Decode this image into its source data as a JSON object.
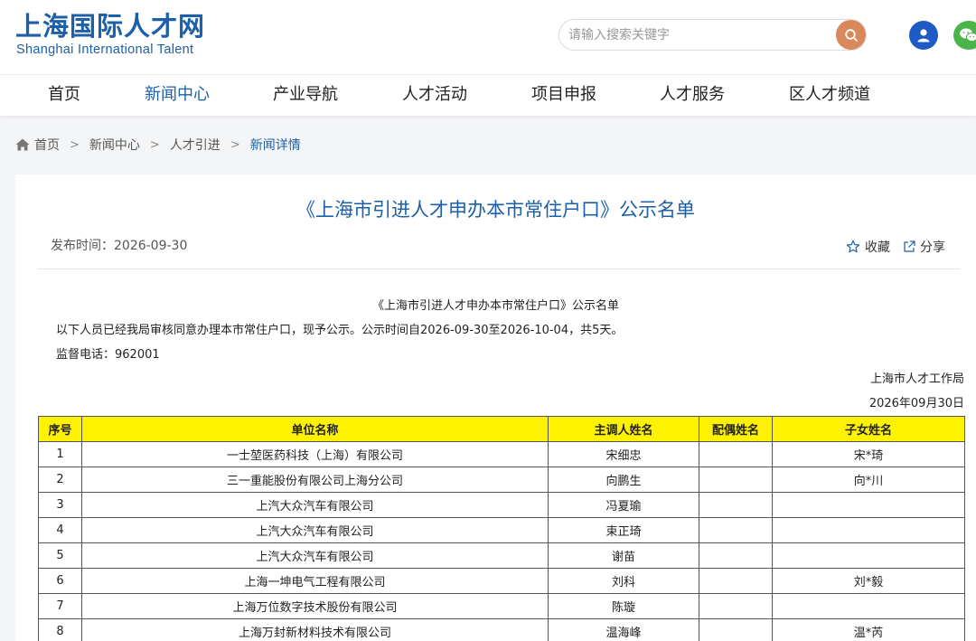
{
  "header": {
    "logo_cn": "上海国际人才网",
    "logo_en": "Shanghai International Talent",
    "search_placeholder": "请输入搜索关键字",
    "brand_color": "#1d5fa8",
    "search_button_color": "#d9885c",
    "user_icon": "user-icon",
    "wechat_icon": "wechat-icon"
  },
  "nav": {
    "items": [
      {
        "label": "首页"
      },
      {
        "label": "新闻中心",
        "active": true
      },
      {
        "label": "产业导航"
      },
      {
        "label": "人才活动"
      },
      {
        "label": "项目申报"
      },
      {
        "label": "人才服务"
      },
      {
        "label": "区人才频道"
      }
    ]
  },
  "breadcrumb": {
    "items": [
      "首页",
      "新闻中心",
      "人才引进",
      "新闻详情"
    ]
  },
  "article": {
    "title": "《上海市引进人才申办本市常住户口》公示名单",
    "publish_time": "发布时间：2026-09-30",
    "favorite_label": "收藏",
    "share_label": "分享",
    "body_title": "《上海市引进人才申办本市常住户口》公示名单",
    "intro": "以下人员已经我局审核同意办理本市常住户口，现予公示。公示时间自2026-09-30至2026-10-04，共5天。",
    "hotline": "监督电话：962001",
    "issuer": "上海市人才工作局",
    "issue_date": "2026年09月30日"
  },
  "table": {
    "header_color": "#fff200",
    "headers": [
      "序号",
      "单位名称",
      "主调人姓名",
      "配偶姓名",
      "子女姓名"
    ],
    "rows": [
      [
        "1",
        "一士堃医药科技（上海）有限公司",
        "宋细忠",
        "",
        "宋*琦"
      ],
      [
        "2",
        "三一重能股份有限公司上海分公司",
        "向鹏生",
        "",
        "向*川"
      ],
      [
        "3",
        "上汽大众汽车有限公司",
        "冯夏瑜",
        "",
        ""
      ],
      [
        "4",
        "上汽大众汽车有限公司",
        "束正琦",
        "",
        ""
      ],
      [
        "5",
        "上汽大众汽车有限公司",
        "谢苗",
        "",
        ""
      ],
      [
        "6",
        "上海一坤电气工程有限公司",
        "刘科",
        "",
        "刘*毅"
      ],
      [
        "7",
        "上海万位数字技术股份有限公司",
        "陈璇",
        "",
        ""
      ],
      [
        "8",
        "上海万封新材料技术有限公司",
        "温海峰",
        "",
        "温*芮"
      ]
    ]
  }
}
